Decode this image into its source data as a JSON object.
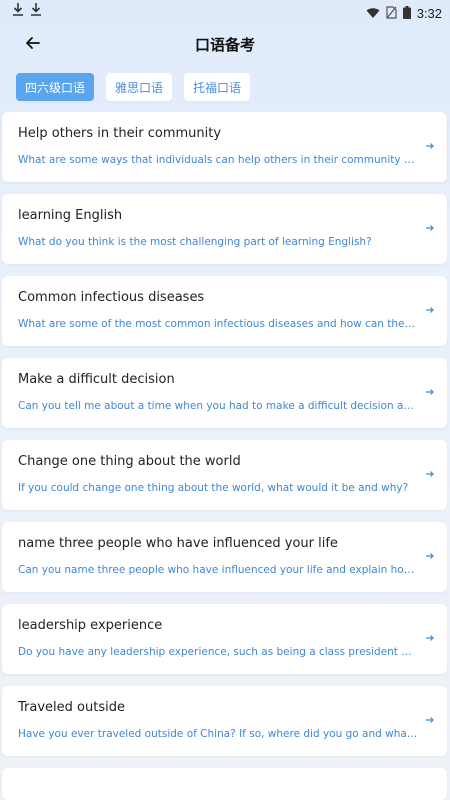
{
  "status_bar": {
    "time": "3:32"
  },
  "header": {
    "title": "口语备考"
  },
  "tabs": [
    {
      "label": "四六级口语",
      "active": true
    },
    {
      "label": "雅思口语",
      "active": false
    },
    {
      "label": "托福口语",
      "active": false
    }
  ],
  "topics": [
    {
      "title": "Help others in their community",
      "question": "What are some ways that individuals can help others in their community or society?"
    },
    {
      "title": "learning English",
      "question": "What do you think is the most challenging part of learning English?"
    },
    {
      "title": "Common infectious diseases",
      "question": "What are some of the most common infectious diseases and how can they be prev..."
    },
    {
      "title": "Make a difficult decision",
      "question": "Can you tell me about a time when you had to make a difficult decision and what fa..."
    },
    {
      "title": "Change one thing about the world",
      "question": "If you could change one thing about the world, what would it be and why?"
    },
    {
      "title": "name three people who have influenced your life",
      "question": "Can you name three people who have influenced your life and explain how they have..."
    },
    {
      "title": "leadership experience",
      "question": "Do you have any leadership experience, such as being a class president or captain ..."
    },
    {
      "title": "Traveled outside",
      "question": "Have you ever traveled outside of China? If so, where did you go and what did you s..."
    }
  ],
  "colors": {
    "accent": "#5aa5ee",
    "link": "#3f86d4"
  },
  "icons": {
    "back": "arrow-left-icon",
    "item_arrow": "arrow-right-icon"
  }
}
